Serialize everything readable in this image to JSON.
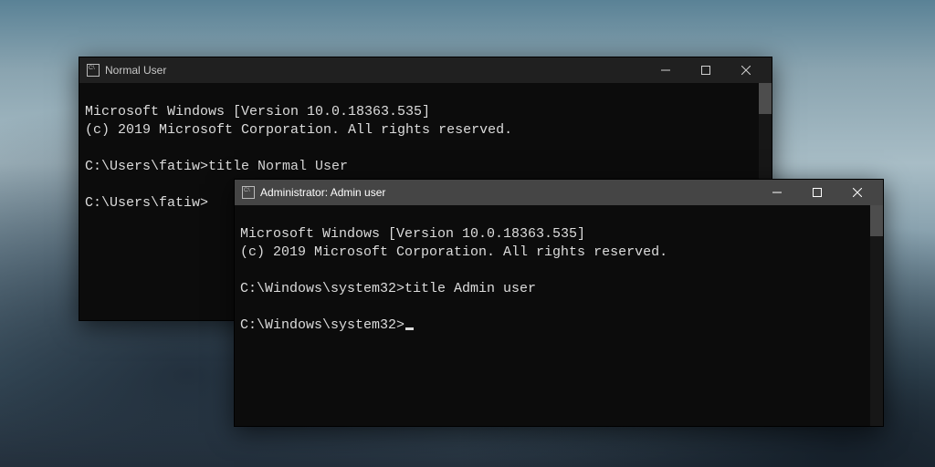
{
  "windows": {
    "normal": {
      "title": "Normal User",
      "lines": {
        "l1": "Microsoft Windows [Version 10.0.18363.535]",
        "l2": "(c) 2019 Microsoft Corporation. All rights reserved.",
        "l3": "",
        "l4": "C:\\Users\\fatiw>title Normal User",
        "l5": "",
        "l6": "C:\\Users\\fatiw>"
      }
    },
    "admin": {
      "title": "Administrator:  Admin user",
      "lines": {
        "l1": "Microsoft Windows [Version 10.0.18363.535]",
        "l2": "(c) 2019 Microsoft Corporation. All rights reserved.",
        "l3": "",
        "l4": "C:\\Windows\\system32>title Admin user",
        "l5": "",
        "l6": "C:\\Windows\\system32>"
      }
    }
  }
}
